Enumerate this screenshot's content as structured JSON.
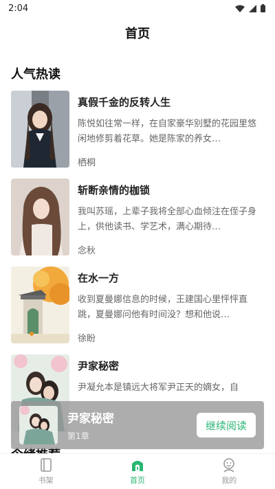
{
  "status_bar": {
    "time": "2:04"
  },
  "header": {
    "title": "首页"
  },
  "section": {
    "title": "人气热读"
  },
  "books": [
    {
      "title": "真假千金的反转人生",
      "desc": "陈悦如往常一样，在自家豪华别墅的花园里悠闲地修剪着花草。她是陈家的养女…",
      "author": "栖桐"
    },
    {
      "title": "斩断亲情的枷锁",
      "desc": "我叫苏瑶，上辈子我将全部心血倾注在侄子身上，供他读书、学艺术，满心期待…",
      "author": "念秋"
    },
    {
      "title": "在水一方",
      "desc": "收到夏曼娜信息的时候，王建国心里怦怦直跳，夏曼娜问他有时间没？想和他说…",
      "author": "徐盼"
    },
    {
      "title": "尹家秘密",
      "desc": "尹凝允本是镇远大将军尹正天的嫡女，自",
      "author": ""
    }
  ],
  "next_section": {
    "title": "今绪推荐"
  },
  "mini_player": {
    "title": "尹家秘密",
    "chapter": "第1章",
    "button": "继续阅读"
  },
  "tabs": [
    {
      "label": "书架",
      "icon": "bookshelf-icon",
      "active": false
    },
    {
      "label": "首页",
      "icon": "home-icon",
      "active": true
    },
    {
      "label": "我的",
      "icon": "profile-icon",
      "active": false
    }
  ],
  "colors": {
    "accent": "#2bb673",
    "player_bg": "#969696"
  }
}
